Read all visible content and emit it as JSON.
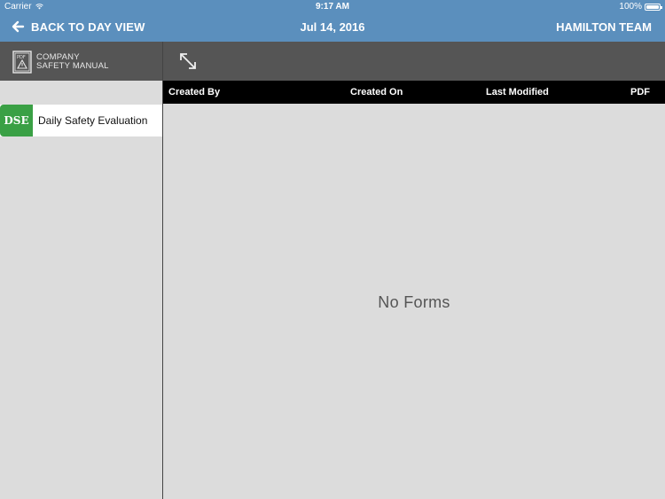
{
  "status_bar": {
    "carrier": "Carrier",
    "time": "9:17 AM",
    "battery": "100%"
  },
  "nav": {
    "back_label": "BACK TO DAY VIEW",
    "title": "Jul 14, 2016",
    "team": "HAMILTON TEAM"
  },
  "sidebar": {
    "manual_line1": "COMPANY",
    "manual_line2": "SAFETY MANUAL",
    "manual_icon_text": "PDF",
    "forms": [
      {
        "badge": "DSE",
        "label": "Daily Safety Evaluation",
        "badge_color": "#3aa045"
      }
    ]
  },
  "table": {
    "columns": [
      "Created By",
      "Created On",
      "Last Modified",
      "PDF"
    ],
    "empty_message": "No Forms"
  },
  "colors": {
    "nav_blue": "#5b8fbd",
    "toolbar_gray": "#555555",
    "background": "#dcdcdc"
  }
}
